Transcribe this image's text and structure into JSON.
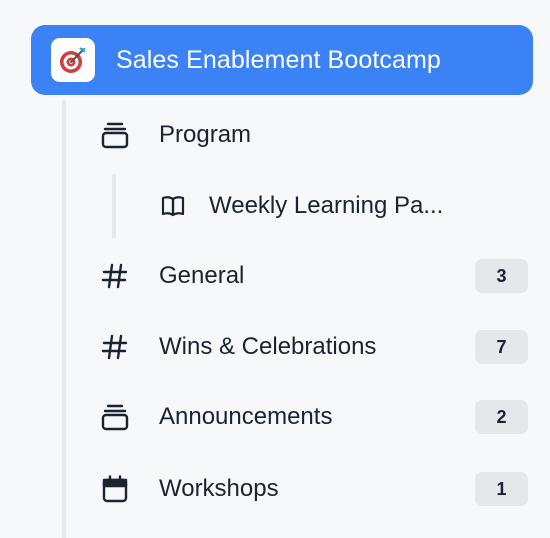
{
  "workspace": {
    "title": "Sales Enablement Bootcamp",
    "logo_icon": "target-dart-icon",
    "accent_color": "#3b82f6"
  },
  "channels": [
    {
      "label": "Program",
      "icon": "stack-icon",
      "badge": ""
    },
    {
      "label": "Weekly Learning Pa...",
      "icon": "book-icon",
      "badge": ""
    },
    {
      "label": "General",
      "icon": "hash-icon",
      "badge": "3"
    },
    {
      "label": "Wins & Celebrations",
      "icon": "hash-icon",
      "badge": "7"
    },
    {
      "label": "Announcements",
      "icon": "stack-icon",
      "badge": "2"
    },
    {
      "label": "Workshops",
      "icon": "calendar-icon",
      "badge": "1"
    }
  ]
}
